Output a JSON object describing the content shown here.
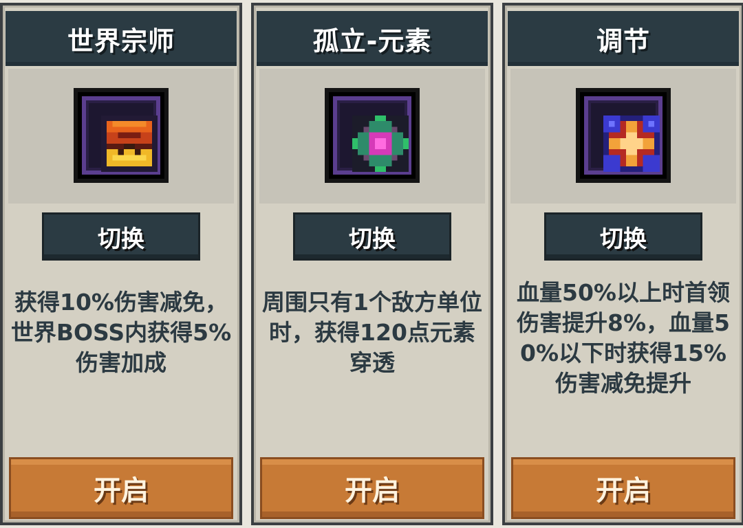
{
  "cards": [
    {
      "title": "世界宗师",
      "icon": "world-master-icon",
      "switch_label": "切换",
      "description": "获得10%伤害减免，世界BOSS内获得5%伤害加成",
      "open_label": "开启"
    },
    {
      "title": "孤立-元素",
      "icon": "isolation-element-icon",
      "switch_label": "切换",
      "description": "周围只有1个敌方单位时，获得120点元素穿透",
      "open_label": "开启"
    },
    {
      "title": "调节",
      "icon": "adjustment-icon",
      "switch_label": "切换",
      "description": "血量50%以上时首领伤害提升8%，血量50%以下时获得15%伤害减免提升",
      "open_label": "开启"
    }
  ],
  "colors": {
    "title_bar": "#2b3b43",
    "card_bg": "#d4d0c3",
    "open_button": "#c77a36",
    "text": "#2c3a42"
  }
}
